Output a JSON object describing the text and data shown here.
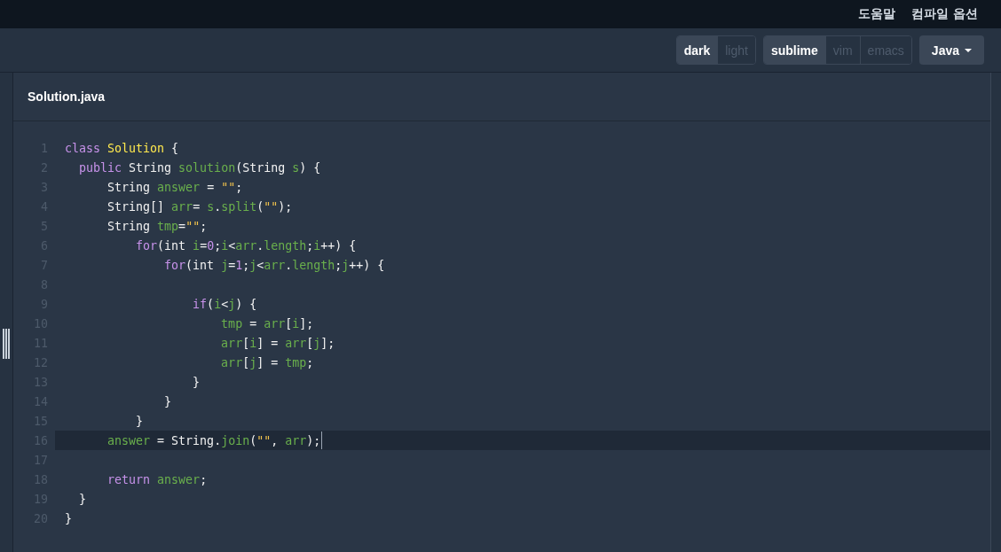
{
  "top_nav": {
    "links": [
      "도움말",
      "컴파일 옵션"
    ]
  },
  "toolbar": {
    "groups": [
      {
        "options": [
          {
            "label": "dark",
            "selected": true
          },
          {
            "label": "light",
            "selected": false
          }
        ]
      },
      {
        "options": [
          {
            "label": "sublime",
            "selected": true
          },
          {
            "label": "vim",
            "selected": false
          },
          {
            "label": "emacs",
            "selected": false
          }
        ]
      }
    ],
    "language": "Java"
  },
  "editor": {
    "filename": "Solution.java",
    "lines": [
      {
        "number": "1",
        "active": false,
        "tokens": [
          {
            "kind": "kw",
            "text": "class"
          },
          {
            "kind": "cls",
            "text": " Solution"
          },
          {
            "kind": "p",
            "text": " {"
          }
        ]
      },
      {
        "number": "2",
        "active": false,
        "tokens": [
          {
            "kind": "kw",
            "text": "  public"
          },
          {
            "kind": "p",
            "text": " String "
          },
          {
            "kind": "var",
            "text": "solution"
          },
          {
            "kind": "p",
            "text": "(String "
          },
          {
            "kind": "var",
            "text": "s"
          },
          {
            "kind": "p",
            "text": ") {"
          }
        ]
      },
      {
        "number": "3",
        "active": false,
        "tokens": [
          {
            "kind": "p",
            "text": "      String "
          },
          {
            "kind": "var",
            "text": "answer"
          },
          {
            "kind": "p",
            "text": " = "
          },
          {
            "kind": "str",
            "text": "\"\""
          },
          {
            "kind": "p",
            "text": ";"
          }
        ]
      },
      {
        "number": "4",
        "active": false,
        "tokens": [
          {
            "kind": "p",
            "text": "      String[] "
          },
          {
            "kind": "var",
            "text": "arr"
          },
          {
            "kind": "p",
            "text": "= "
          },
          {
            "kind": "var",
            "text": "s"
          },
          {
            "kind": "p",
            "text": "."
          },
          {
            "kind": "var",
            "text": "split"
          },
          {
            "kind": "p",
            "text": "("
          },
          {
            "kind": "str",
            "text": "\"\""
          },
          {
            "kind": "p",
            "text": ");"
          }
        ]
      },
      {
        "number": "5",
        "active": false,
        "tokens": [
          {
            "kind": "p",
            "text": "      String "
          },
          {
            "kind": "var",
            "text": "tmp"
          },
          {
            "kind": "p",
            "text": "="
          },
          {
            "kind": "str",
            "text": "\"\""
          },
          {
            "kind": "p",
            "text": ";"
          }
        ]
      },
      {
        "number": "6",
        "active": false,
        "tokens": [
          {
            "kind": "kw",
            "text": "          for"
          },
          {
            "kind": "p",
            "text": "(int "
          },
          {
            "kind": "var",
            "text": "i"
          },
          {
            "kind": "p",
            "text": "="
          },
          {
            "kind": "num",
            "text": "0"
          },
          {
            "kind": "p",
            "text": ";"
          },
          {
            "kind": "var",
            "text": "i"
          },
          {
            "kind": "p",
            "text": "<"
          },
          {
            "kind": "var",
            "text": "arr"
          },
          {
            "kind": "p",
            "text": "."
          },
          {
            "kind": "var",
            "text": "length"
          },
          {
            "kind": "p",
            "text": ";"
          },
          {
            "kind": "var",
            "text": "i"
          },
          {
            "kind": "p",
            "text": "++) {"
          }
        ]
      },
      {
        "number": "7",
        "active": false,
        "tokens": [
          {
            "kind": "kw",
            "text": "              for"
          },
          {
            "kind": "p",
            "text": "(int "
          },
          {
            "kind": "var",
            "text": "j"
          },
          {
            "kind": "p",
            "text": "="
          },
          {
            "kind": "num",
            "text": "1"
          },
          {
            "kind": "p",
            "text": ";"
          },
          {
            "kind": "var",
            "text": "j"
          },
          {
            "kind": "p",
            "text": "<"
          },
          {
            "kind": "var",
            "text": "arr"
          },
          {
            "kind": "p",
            "text": "."
          },
          {
            "kind": "var",
            "text": "length"
          },
          {
            "kind": "p",
            "text": ";"
          },
          {
            "kind": "var",
            "text": "j"
          },
          {
            "kind": "p",
            "text": "++) {"
          }
        ]
      },
      {
        "number": "8",
        "active": false
      },
      {
        "number": "9",
        "active": false,
        "tokens": [
          {
            "kind": "kw",
            "text": "                  if"
          },
          {
            "kind": "p",
            "text": "("
          },
          {
            "kind": "var",
            "text": "i"
          },
          {
            "kind": "p",
            "text": "<"
          },
          {
            "kind": "var",
            "text": "j"
          },
          {
            "kind": "p",
            "text": ") {"
          }
        ]
      },
      {
        "number": "10",
        "active": false,
        "tokens": [
          {
            "kind": "var",
            "text": "                      tmp"
          },
          {
            "kind": "p",
            "text": " = "
          },
          {
            "kind": "var",
            "text": "arr"
          },
          {
            "kind": "p",
            "text": "["
          },
          {
            "kind": "var",
            "text": "i"
          },
          {
            "kind": "p",
            "text": "];"
          }
        ]
      },
      {
        "number": "11",
        "active": false,
        "tokens": [
          {
            "kind": "var",
            "text": "                      arr"
          },
          {
            "kind": "p",
            "text": "["
          },
          {
            "kind": "var",
            "text": "i"
          },
          {
            "kind": "p",
            "text": "] = "
          },
          {
            "kind": "var",
            "text": "arr"
          },
          {
            "kind": "p",
            "text": "["
          },
          {
            "kind": "var",
            "text": "j"
          },
          {
            "kind": "p",
            "text": "];"
          }
        ]
      },
      {
        "number": "12",
        "active": false,
        "tokens": [
          {
            "kind": "var",
            "text": "                      arr"
          },
          {
            "kind": "p",
            "text": "["
          },
          {
            "kind": "var",
            "text": "j"
          },
          {
            "kind": "p",
            "text": "] = "
          },
          {
            "kind": "var",
            "text": "tmp"
          },
          {
            "kind": "p",
            "text": ";"
          }
        ]
      },
      {
        "number": "13",
        "active": false,
        "tokens": [
          {
            "kind": "p",
            "text": "                  }"
          }
        ]
      },
      {
        "number": "14",
        "active": false,
        "tokens": [
          {
            "kind": "p",
            "text": "              }"
          }
        ]
      },
      {
        "number": "15",
        "active": false,
        "tokens": [
          {
            "kind": "p",
            "text": "          }"
          }
        ]
      },
      {
        "number": "16",
        "active": true,
        "tokens": [
          {
            "kind": "var",
            "text": "      answer"
          },
          {
            "kind": "p",
            "text": " = String."
          },
          {
            "kind": "var",
            "text": "join"
          },
          {
            "kind": "p",
            "text": "("
          },
          {
            "kind": "str",
            "text": "\"\""
          },
          {
            "kind": "p",
            "text": ", "
          },
          {
            "kind": "var",
            "text": "arr"
          },
          {
            "kind": "p",
            "text": ");"
          }
        ]
      },
      {
        "number": "17",
        "active": false
      },
      {
        "number": "18",
        "active": false,
        "tokens": [
          {
            "kind": "kw",
            "text": "      return"
          },
          {
            "kind": "var",
            "text": " answer"
          },
          {
            "kind": "p",
            "text": ";"
          }
        ]
      },
      {
        "number": "19",
        "active": false,
        "tokens": [
          {
            "kind": "p",
            "text": "  }"
          }
        ]
      },
      {
        "number": "20",
        "active": false,
        "tokens": [
          {
            "kind": "p",
            "text": "}"
          }
        ]
      }
    ]
  }
}
